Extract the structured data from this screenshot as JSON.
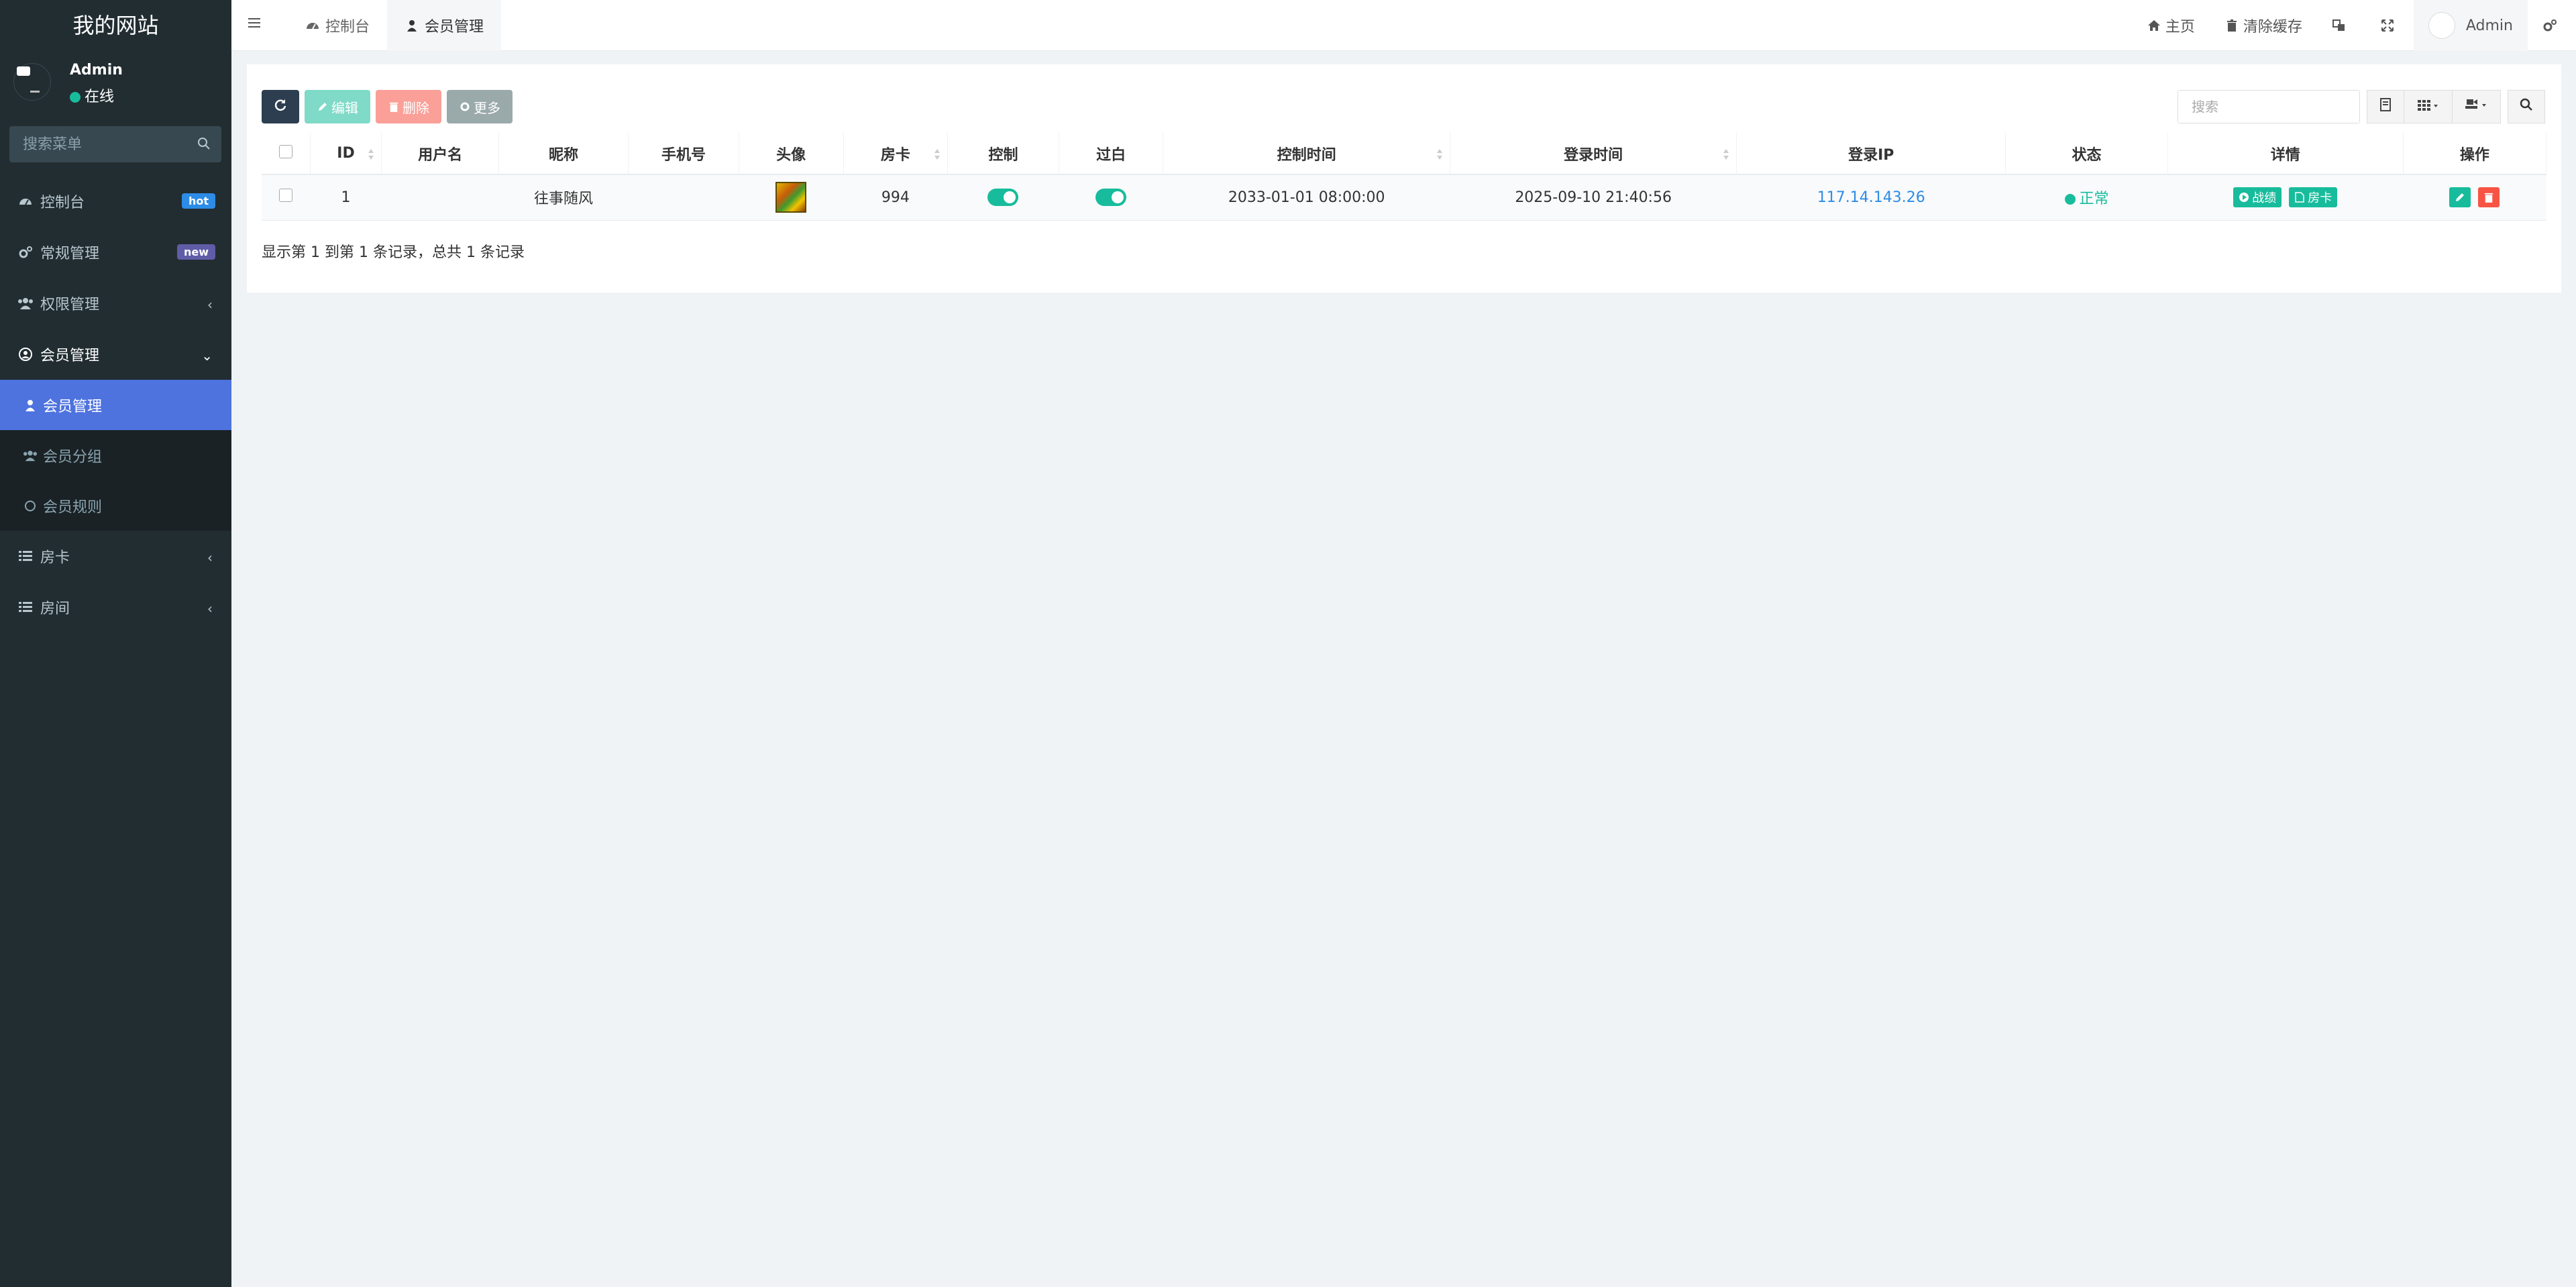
{
  "app": {
    "title": "我的网站"
  },
  "user": {
    "name": "Admin",
    "status": "在线"
  },
  "sidebar": {
    "search_placeholder": "搜索菜单",
    "items": [
      {
        "label": "控制台",
        "badge": "hot",
        "badge_color": "#2c8ce6"
      },
      {
        "label": "常规管理",
        "badge": "new",
        "badge_color": "#605ca8"
      },
      {
        "label": "权限管理"
      },
      {
        "label": "会员管理"
      },
      {
        "label": "房卡"
      },
      {
        "label": "房间"
      }
    ],
    "submenu": [
      {
        "label": "会员管理"
      },
      {
        "label": "会员分组"
      },
      {
        "label": "会员规则"
      }
    ]
  },
  "topbar": {
    "tabs": [
      {
        "label": "控制台"
      },
      {
        "label": "会员管理"
      }
    ],
    "home": "主页",
    "clear_cache": "清除缓存",
    "username": "Admin"
  },
  "toolbar": {
    "edit": "编辑",
    "delete": "删除",
    "more": "更多",
    "search_placeholder": "搜索"
  },
  "table": {
    "headers": [
      "ID",
      "用户名",
      "昵称",
      "手机号",
      "头像",
      "房卡",
      "控制",
      "过白",
      "控制时间",
      "登录时间",
      "登录IP",
      "状态",
      "详情",
      "操作"
    ],
    "rows": [
      {
        "id": "1",
        "username": "",
        "nickname": "往事随风",
        "mobile": "",
        "room_card": "994",
        "control": true,
        "whitelist": true,
        "control_time": "2033-01-01 08:00:00",
        "login_time": "2025-09-10 21:40:56",
        "login_ip": "117.14.143.26",
        "status": "正常",
        "detail_buttons": [
          "战绩",
          "房卡"
        ]
      }
    ]
  },
  "pagination": {
    "info": "显示第 1 到第 1 条记录，总共 1 条记录"
  },
  "colors": {
    "sidebar_bg": "#222d32",
    "active_blue": "#4e73df",
    "success": "#18bc9c",
    "danger": "#f75444",
    "primary_dark": "#2c3e50"
  }
}
